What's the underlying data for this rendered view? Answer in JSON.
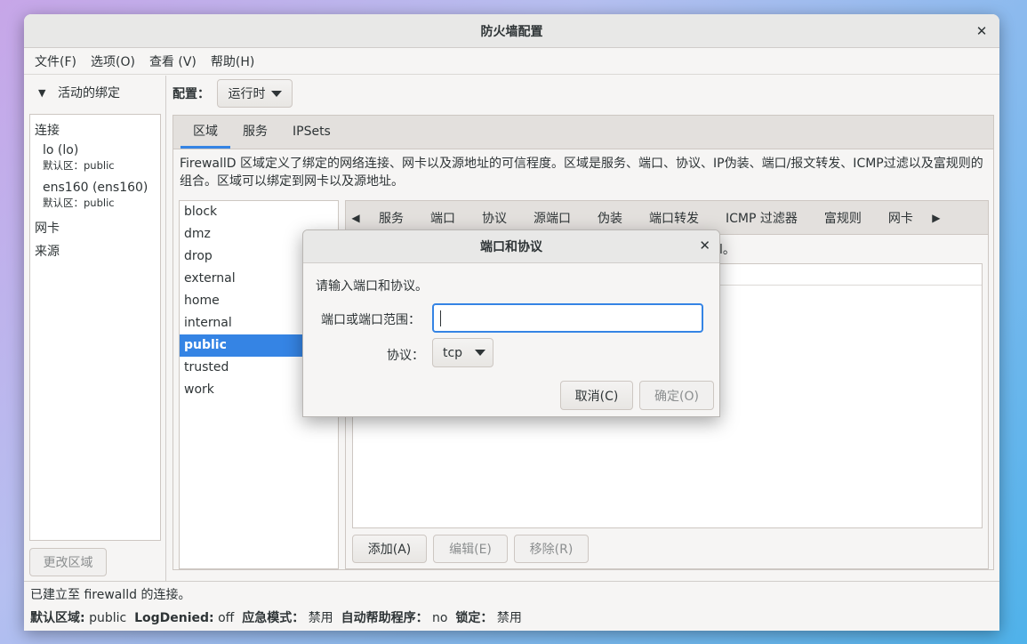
{
  "window": {
    "title": "防火墙配置"
  },
  "menu": [
    "文件(F)",
    "选项(O)",
    "查看 (V)",
    "帮助(H)"
  ],
  "bindings": {
    "expander": "活动的绑定",
    "connections_header": "连接",
    "connections": [
      {
        "name": "lo (lo)",
        "zone": "默认区：public"
      },
      {
        "name": "ens160 (ens160)",
        "zone": "默认区：public"
      }
    ],
    "interfaces_header": "网卡",
    "sources_header": "来源",
    "change_zone_button": "更改区域"
  },
  "config": {
    "label": "配置：",
    "value": "运行时"
  },
  "tabs": [
    "区域",
    "服务",
    "IPSets"
  ],
  "description": "FirewallD 区域定义了绑定的网络连接、网卡以及源地址的可信程度。区域是服务、端口、协议、IP伪装、端口/报文转发、ICMP过滤以及富规则的组合。区域可以绑定到网卡以及源地址。",
  "zones": [
    "block",
    "dmz",
    "drop",
    "external",
    "home",
    "internal",
    "public",
    "trusted",
    "work"
  ],
  "selected_zone": "public",
  "subtabs": [
    "服务",
    "端口",
    "协议",
    "源端口",
    "伪装",
    "端口转发",
    "ICMP 过滤器",
    "富规则",
    "网卡"
  ],
  "subnote_fragment": "l。",
  "buttons": {
    "add": "添加(A)",
    "edit": "编辑(E)",
    "remove": "移除(R)"
  },
  "status": {
    "connection": "已建立至 firewalld 的连接。",
    "default_zone_label": "默认区域:",
    "default_zone_value": "public",
    "logdenied_label": "LogDenied:",
    "logdenied_value": "off",
    "panic_label": "应急模式：",
    "panic_value": "禁用",
    "helpers_label": "自动帮助程序：",
    "helpers_value": "no",
    "lockdown_label": "锁定：",
    "lockdown_value": "禁用"
  },
  "dialog": {
    "title": "端口和协议",
    "prompt": "请输入端口和协议。",
    "port_label": "端口或端口范围：",
    "port_value": "",
    "protocol_label": "协议：",
    "protocol_value": "tcp",
    "cancel": "取消(C)",
    "ok": "确定(O)"
  },
  "colors": {
    "accent": "#3584e4"
  }
}
